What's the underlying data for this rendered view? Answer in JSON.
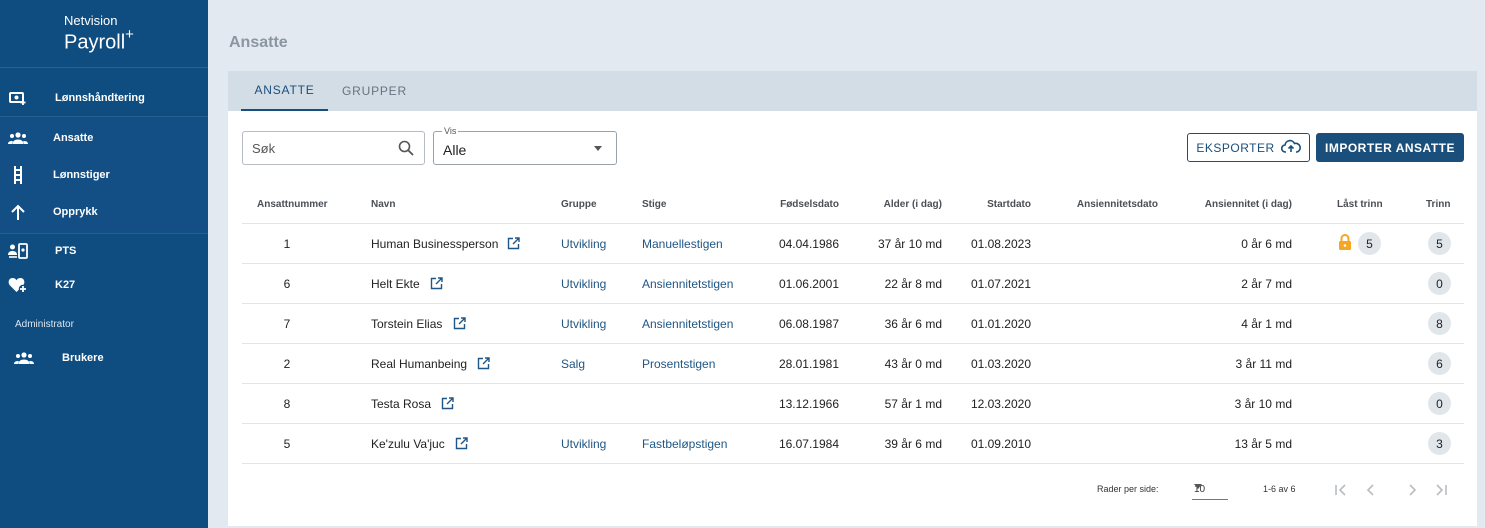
{
  "brand": {
    "top": "Netvision",
    "main": "Payroll",
    "mark": "+"
  },
  "sidebar": {
    "items": [
      {
        "label": "Lønnshåndtering",
        "icon": "money-add-icon"
      },
      {
        "label": "Ansatte",
        "icon": "people-icon"
      },
      {
        "label": "Lønnstiger",
        "icon": "ladder-icon"
      },
      {
        "label": "Opprykk",
        "icon": "arrow-up-icon"
      },
      {
        "label": "PTS",
        "icon": "id-card-icon"
      },
      {
        "label": "K27",
        "icon": "heart-add-icon"
      }
    ],
    "section_label": "Administrator",
    "admin_items": [
      {
        "label": "Brukere",
        "icon": "people-icon"
      }
    ]
  },
  "page": {
    "title": "Ansatte"
  },
  "tabs": [
    {
      "label": "ANSATTE",
      "active": true
    },
    {
      "label": "GRUPPER",
      "active": false
    }
  ],
  "filters": {
    "search_placeholder": "Søk",
    "vis_label": "Vis",
    "vis_value": "Alle"
  },
  "actions": {
    "export_label": "EKSPORTER",
    "import_label": "IMPORTER ANSATTE"
  },
  "table": {
    "headers": [
      "Ansattnummer",
      "Navn",
      "Gruppe",
      "Stige",
      "Fødselsdato",
      "Alder (i dag)",
      "Startdato",
      "Ansiennitetsdato",
      "Ansiennitet (i dag)",
      "Låst trinn",
      "Trinn"
    ],
    "rows": [
      {
        "nr": "1",
        "name": "Human Businessperson",
        "group": "Utvikling",
        "ladder": "Manuellestigen",
        "birth": "04.04.1986",
        "age": "37 år 10 md",
        "start": "01.08.2023",
        "seniority_date": "",
        "seniority": "0 år 6 md",
        "locked": "5",
        "step": "5"
      },
      {
        "nr": "6",
        "name": "Helt Ekte",
        "group": "Utvikling",
        "ladder": "Ansiennitetstigen",
        "birth": "01.06.2001",
        "age": "22 år 8 md",
        "start": "01.07.2021",
        "seniority_date": "",
        "seniority": "2 år 7 md",
        "locked": "",
        "step": "0"
      },
      {
        "nr": "7",
        "name": "Torstein Elias",
        "group": "Utvikling",
        "ladder": "Ansiennitetstigen",
        "birth": "06.08.1987",
        "age": "36 år 6 md",
        "start": "01.01.2020",
        "seniority_date": "",
        "seniority": "4 år 1 md",
        "locked": "",
        "step": "8"
      },
      {
        "nr": "2",
        "name": "Real Humanbeing",
        "group": "Salg",
        "ladder": "Prosentstigen",
        "birth": "28.01.1981",
        "age": "43 år 0 md",
        "start": "01.03.2020",
        "seniority_date": "",
        "seniority": "3 år 11 md",
        "locked": "",
        "step": "6"
      },
      {
        "nr": "8",
        "name": "Testa Rosa",
        "group": "",
        "ladder": "",
        "birth": "13.12.1966",
        "age": "57 år 1 md",
        "start": "12.03.2020",
        "seniority_date": "",
        "seniority": "3 år 10 md",
        "locked": "",
        "step": "0"
      },
      {
        "nr": "5",
        "name": "Ke'zulu Va'juc",
        "group": "Utvikling",
        "ladder": "Fastbeløpstigen",
        "birth": "16.07.1984",
        "age": "39 år 6 md",
        "start": "01.09.2010",
        "seniority_date": "",
        "seniority": "13 år 5 md",
        "locked": "",
        "step": "3"
      }
    ]
  },
  "pagination": {
    "rows_per_page_label": "Rader per side:",
    "rows_per_page": "10",
    "range": "1-6 av 6"
  },
  "colors": {
    "sidebar": "#0f4c7f",
    "accent": "#1a4f7c",
    "lock": "#f5a623"
  }
}
